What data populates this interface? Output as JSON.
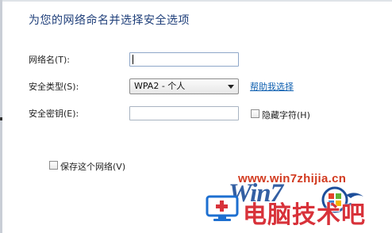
{
  "dialog": {
    "title": "为您的网络命名并选择安全选项",
    "network_name_label": "网络名(T):",
    "network_name_value": "",
    "security_type_label": "安全类型(S):",
    "security_type_value": "WPA2 - 个人",
    "help_link": "帮助我选择",
    "security_key_label": "安全密钥(E):",
    "security_key_value": "",
    "hide_chars_label": "隐藏字符(H)",
    "hide_chars_checked": false,
    "save_network_label": "保存这个网络(V)",
    "save_network_checked": false
  },
  "watermark": {
    "url": "www.win7zhijia.cn",
    "brand": "Win7",
    "chinese": "电脑技术吧",
    "logo_icon": "computer-plus-icon",
    "flag_icon": "windows-flag-icon",
    "colors": {
      "red": "#d8323a",
      "blue": "#1d4e9a"
    }
  }
}
